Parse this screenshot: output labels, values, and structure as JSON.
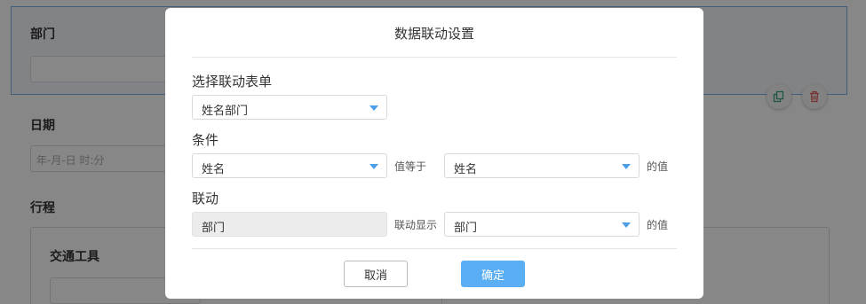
{
  "background": {
    "dept_label": "部门",
    "date_label": "日期",
    "date_placeholder": "年-月-日 时:分",
    "trip_label": "行程",
    "transport_label": "交通工具"
  },
  "modal": {
    "title": "数据联动设置",
    "form_select": {
      "label": "选择联动表单",
      "value": "姓名部门"
    },
    "condition": {
      "label": "条件",
      "left_value": "姓名",
      "operator": "值等于",
      "right_value": "姓名",
      "suffix": "的值"
    },
    "linkage": {
      "label": "联动",
      "source_value": "部门",
      "action": "联动显示",
      "target_value": "部门",
      "suffix": "的值"
    },
    "cancel_label": "取消",
    "ok_label": "确定"
  },
  "colors": {
    "accent": "#5aaef3",
    "caret": "#4a9fe8",
    "selected_section_border": "#7cb4e8",
    "delete": "#e05a5a",
    "copy": "#3aa57a"
  },
  "icons": [
    "copy-icon",
    "trash-icon",
    "chevron-down-icon"
  ]
}
